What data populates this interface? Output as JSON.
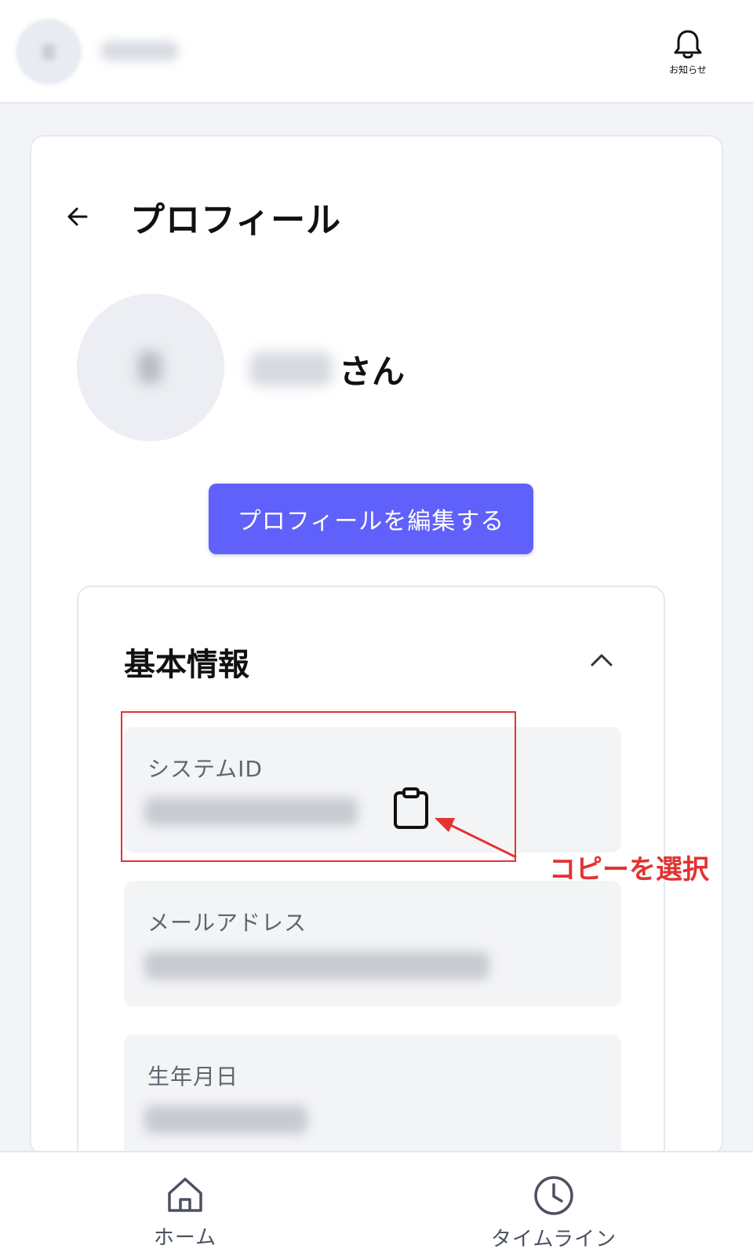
{
  "header": {
    "notifications_label": "お知らせ"
  },
  "profile": {
    "title": "プロフィール",
    "name_suffix": "さん",
    "edit_button": "プロフィールを編集する"
  },
  "basic_info": {
    "title": "基本情報",
    "fields": [
      {
        "label": "システムID"
      },
      {
        "label": "メールアドレス"
      },
      {
        "label": "生年月日"
      }
    ]
  },
  "annotation": {
    "text": "コピーを選択",
    "color": "#e23232"
  },
  "bottom_nav": {
    "items": [
      {
        "label": "ホーム",
        "icon": "home-icon"
      },
      {
        "label": "タイムライン",
        "icon": "clock-icon"
      }
    ]
  },
  "colors": {
    "accent": "#6061fa",
    "background": "#f3f4f7"
  }
}
